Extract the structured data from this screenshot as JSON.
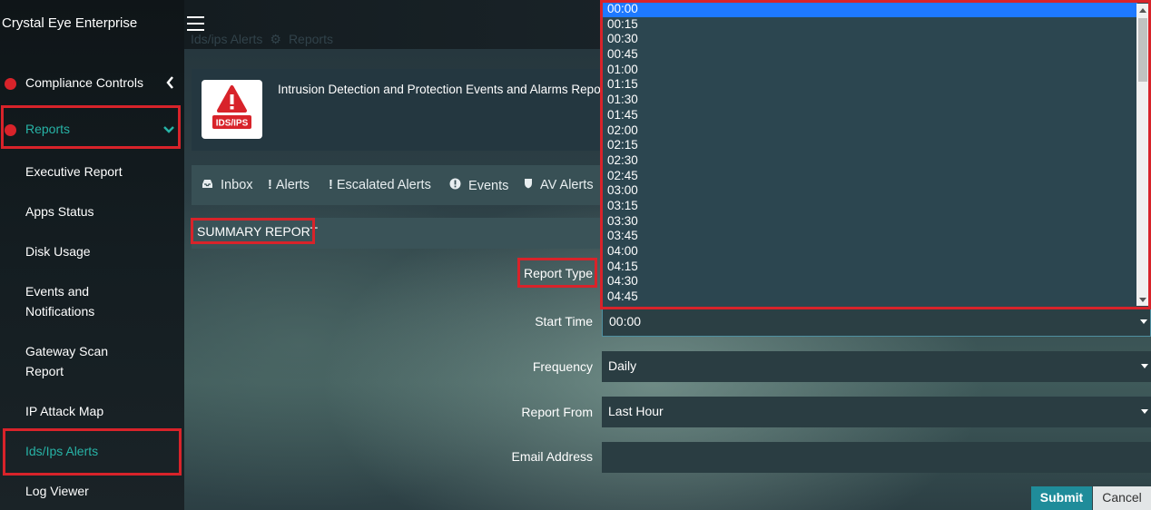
{
  "app": {
    "brand": "Crystal Eye Enterprise",
    "breadcrumb": [
      "Ids/ips Alerts",
      "Reports"
    ],
    "breadcrumb_separator": "⚙"
  },
  "sidebar": {
    "compliance": "Compliance Controls",
    "reports": "Reports",
    "items": [
      "Executive Report",
      "Apps Status",
      "Disk Usage",
      "Events and Notifications",
      "Gateway Scan Report",
      "IP Attack Map",
      "Ids/Ips Alerts",
      "Log Viewer"
    ],
    "active_color": "#27b3a6"
  },
  "header": {
    "logo_text": "IDS/IPS",
    "title": "Intrusion Detection and Protection Events and Alarms Report"
  },
  "tabs": [
    {
      "icon": "inbox-icon",
      "label": "Inbox"
    },
    {
      "icon": "exclamation-icon",
      "label": "Alerts"
    },
    {
      "icon": "exclamation-icon",
      "label": "Escalated Alerts"
    },
    {
      "icon": "exclamation-circle-icon",
      "label": "Events"
    },
    {
      "icon": "shield-icon",
      "label": "AV Alerts"
    }
  ],
  "summary": {
    "label": "SUMMARY REPORT"
  },
  "form": {
    "report_type_label": "Report Type",
    "start_time_label": "Start Time",
    "start_time_value": "00:00",
    "frequency_label": "Frequency",
    "frequency_value": "Daily",
    "report_from_label": "Report From",
    "report_from_value": "Last Hour",
    "email_label": "Email Address",
    "email_value": "",
    "submit_label": "Submit",
    "cancel_label": "Cancel"
  },
  "dropdown": {
    "selected": "00:00",
    "options": [
      "00:00",
      "00:15",
      "00:30",
      "00:45",
      "01:00",
      "01:15",
      "01:30",
      "01:45",
      "02:00",
      "02:15",
      "02:30",
      "02:45",
      "03:00",
      "03:15",
      "03:30",
      "03:45",
      "04:00",
      "04:15",
      "04:30",
      "04:45"
    ]
  },
  "colors": {
    "highlight": "#d8232a",
    "submit": "#1f8c9a",
    "dropdown_selected": "#1e79ff"
  }
}
